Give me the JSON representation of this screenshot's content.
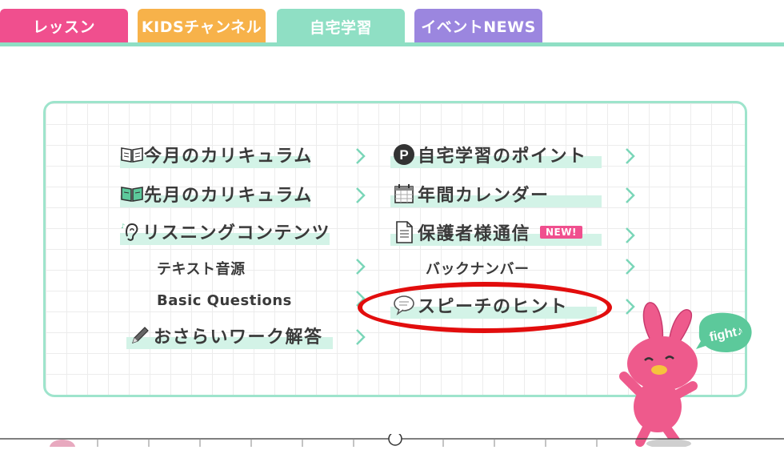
{
  "tabs": [
    {
      "label": "レッスン",
      "color": "#f04f8e"
    },
    {
      "label": "KIDSチャンネル",
      "color": "#f7b24a"
    },
    {
      "label": "自宅学習",
      "color": "#8fdfc4"
    },
    {
      "label": "イベントNEWS",
      "color": "#9b86df"
    }
  ],
  "menu": {
    "left": [
      {
        "label": "今月のカリキュラム",
        "icon": "open-book-icon"
      },
      {
        "label": "先月のカリキュラム",
        "icon": "green-book-icon"
      },
      {
        "label": "リスニングコンテンツ",
        "icon": "ear-icon"
      },
      {
        "label": "テキスト音源",
        "icon": ""
      },
      {
        "label": "Basic Questions",
        "icon": ""
      },
      {
        "label": "おさらいワーク解答",
        "icon": "pencil-icon"
      }
    ],
    "right": [
      {
        "label": "自宅学習のポイント",
        "icon": "p-circle-icon"
      },
      {
        "label": "年間カレンダー",
        "icon": "calendar-icon"
      },
      {
        "label": "保護者様通信",
        "icon": "document-icon",
        "badge": "NEW!"
      },
      {
        "label": "バックナンバー",
        "icon": ""
      },
      {
        "label": "スピーチのヒント",
        "icon": "speech-bubble-icon"
      }
    ]
  },
  "mascot": {
    "bubble_text": "fight♪"
  },
  "colors": {
    "highlight": "#d3f3e7",
    "chevron": "#7ad6b8",
    "annotation": "#e20d0d"
  }
}
